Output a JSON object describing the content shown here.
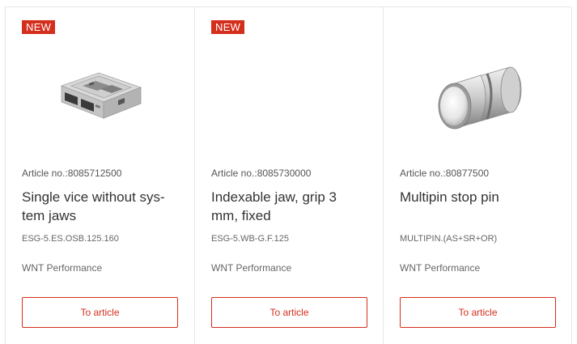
{
  "products": [
    {
      "badge": "NEW",
      "image_icon": "vice-product-image",
      "article_no": "Article no.:8085712500",
      "title": "Single vice without sys-\ntem jaws",
      "code": "ESG-5.ES.OSB.125.160",
      "brand": "WNT Performance",
      "button_label": "To article"
    },
    {
      "badge": "NEW",
      "image_icon": "",
      "article_no": "Article no.:8085730000",
      "title": "Indexable jaw, grip 3\nmm, fixed",
      "code": "ESG-5.WB-G.F.125",
      "brand": "WNT Performance",
      "button_label": "To article"
    },
    {
      "badge": "",
      "image_icon": "stop-pin-product-image",
      "article_no": "Article no.:80877500",
      "title": "Multipin stop pin",
      "code": "MULTIPIN.(AS+SR+OR)",
      "brand": "WNT Performance",
      "button_label": "To article"
    }
  ],
  "colors": {
    "accent": "#d42e1c",
    "border": "#e6e6e6",
    "text": "#333333",
    "muted": "#666666"
  }
}
